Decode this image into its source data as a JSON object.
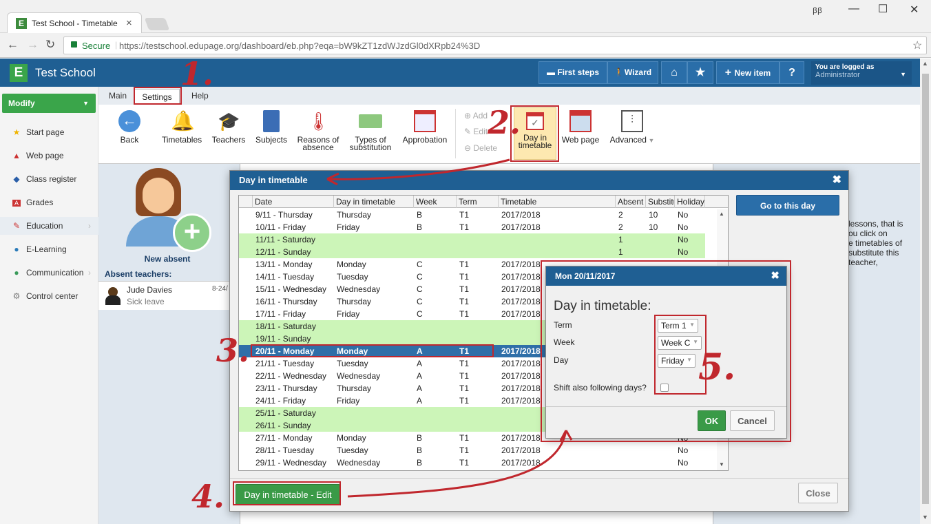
{
  "browser": {
    "tab_title": "Test School - Timetable",
    "secure": "Secure",
    "url": "https://testschool.edupage.org/dashboard/eb.php?eqa=bW9kZT1zdWJzdGl0dXRpb24%3D",
    "fav": "E"
  },
  "header": {
    "school": "Test School",
    "first_steps": "First steps",
    "wizard": "Wizard",
    "new_item": "New item",
    "help": "?",
    "login_label": "You are logged as",
    "login_user": "Administrator"
  },
  "nav": {
    "modify": "Modify",
    "items": [
      "Start page",
      "Web page",
      "Class register",
      "Grades",
      "Education",
      "E-Learning",
      "Communication",
      "Control center"
    ]
  },
  "menu": {
    "tabs": [
      "Main",
      "Settings",
      "Help"
    ]
  },
  "ribbon": {
    "back": "Back",
    "timetables": "Timetables",
    "teachers": "Teachers",
    "subjects": "Subjects",
    "reasons": [
      "Reasons of",
      "absence"
    ],
    "types": [
      "Types of",
      "substitution"
    ],
    "approbation": "Approbation",
    "add": "Add",
    "edit": "Edit",
    "delete": "Delete",
    "day_in_tt": [
      "Day in",
      "timetable"
    ],
    "web_page": "Web page",
    "advanced": "Advanced"
  },
  "absent": {
    "new_absent": "New absent",
    "title": "Absent teachers:",
    "name": "Jude Davies",
    "reason": "Sick leave",
    "date": "8-24/"
  },
  "side_text": [
    "lessons, that is",
    "ou click on",
    "e timetables of",
    "substitute this",
    "teacher,"
  ],
  "dialog": {
    "title": "Day in timetable",
    "goto": "Go to this day",
    "edit_btn": "Day in timetable - Edit",
    "close": "Close",
    "columns": [
      "Date",
      "Day in timetable",
      "Week",
      "Term",
      "Timetable",
      "Absent",
      "Substitu",
      "Holiday"
    ],
    "rows": [
      [
        "9/11 - Thursday",
        "Thursday",
        "B",
        "T1",
        "2017/2018",
        "2",
        "10",
        "No"
      ],
      [
        "10/11 - Friday",
        "Friday",
        "B",
        "T1",
        "2017/2018",
        "2",
        "10",
        "No"
      ],
      [
        "11/11 - Saturday",
        "",
        "",
        "",
        "",
        "1",
        "",
        "No"
      ],
      [
        "12/11 - Sunday",
        "",
        "",
        "",
        "",
        "1",
        "",
        "No"
      ],
      [
        "13/11 - Monday",
        "Monday",
        "C",
        "T1",
        "2017/2018",
        "",
        "",
        ""
      ],
      [
        "14/11 - Tuesday",
        "Tuesday",
        "C",
        "T1",
        "2017/2018",
        "",
        "",
        ""
      ],
      [
        "15/11 - Wednesday",
        "Wednesday",
        "C",
        "T1",
        "2017/2018",
        "",
        "",
        ""
      ],
      [
        "16/11 - Thursday",
        "Thursday",
        "C",
        "T1",
        "2017/2018",
        "",
        "",
        ""
      ],
      [
        "17/11 - Friday",
        "Friday",
        "C",
        "T1",
        "2017/2018",
        "",
        "",
        ""
      ],
      [
        "18/11 - Saturday",
        "",
        "",
        "",
        "",
        "",
        "",
        ""
      ],
      [
        "19/11 - Sunday",
        "",
        "",
        "",
        "",
        "",
        "",
        ""
      ],
      [
        "20/11 - Monday",
        "Monday",
        "A",
        "T1",
        "2017/2018",
        "",
        "",
        ""
      ],
      [
        "21/11 - Tuesday",
        "Tuesday",
        "A",
        "T1",
        "2017/2018",
        "",
        "",
        ""
      ],
      [
        "22/11 - Wednesday",
        "Wednesday",
        "A",
        "T1",
        "2017/2018",
        "",
        "",
        ""
      ],
      [
        "23/11 - Thursday",
        "Thursday",
        "A",
        "T1",
        "2017/2018",
        "",
        "",
        ""
      ],
      [
        "24/11 - Friday",
        "Friday",
        "A",
        "T1",
        "2017/2018",
        "",
        "",
        ""
      ],
      [
        "25/11 - Saturday",
        "",
        "",
        "",
        "",
        "",
        "",
        ""
      ],
      [
        "26/11 - Sunday",
        "",
        "",
        "",
        "",
        "",
        "",
        ""
      ],
      [
        "27/11 - Monday",
        "Monday",
        "B",
        "T1",
        "2017/2018",
        "",
        "",
        "No"
      ],
      [
        "28/11 - Tuesday",
        "Tuesday",
        "B",
        "T1",
        "2017/2018",
        "",
        "",
        "No"
      ],
      [
        "29/11 - Wednesday",
        "Wednesday",
        "B",
        "T1",
        "2017/2018",
        "",
        "",
        "No"
      ]
    ],
    "weekend_rows": [
      2,
      3,
      9,
      10,
      16,
      17
    ],
    "selected_row": 11
  },
  "edit": {
    "title": "Mon 20/11/2017",
    "heading": "Day in timetable:",
    "term_label": "Term",
    "term": "Term 1",
    "week_label": "Week",
    "week": "Week C",
    "day_label": "Day",
    "day": "Friday",
    "shift_label": "Shift also following days?",
    "ok": "OK",
    "cancel": "Cancel"
  },
  "annotations": [
    "1.",
    "2.",
    "3.",
    "4.",
    "5."
  ],
  "colors": {
    "brand": "#1f5f93",
    "green": "#3aa54a",
    "weekend": "#ccf5b8",
    "selected": "#2f6fa8",
    "annotation": "#c0272d"
  }
}
